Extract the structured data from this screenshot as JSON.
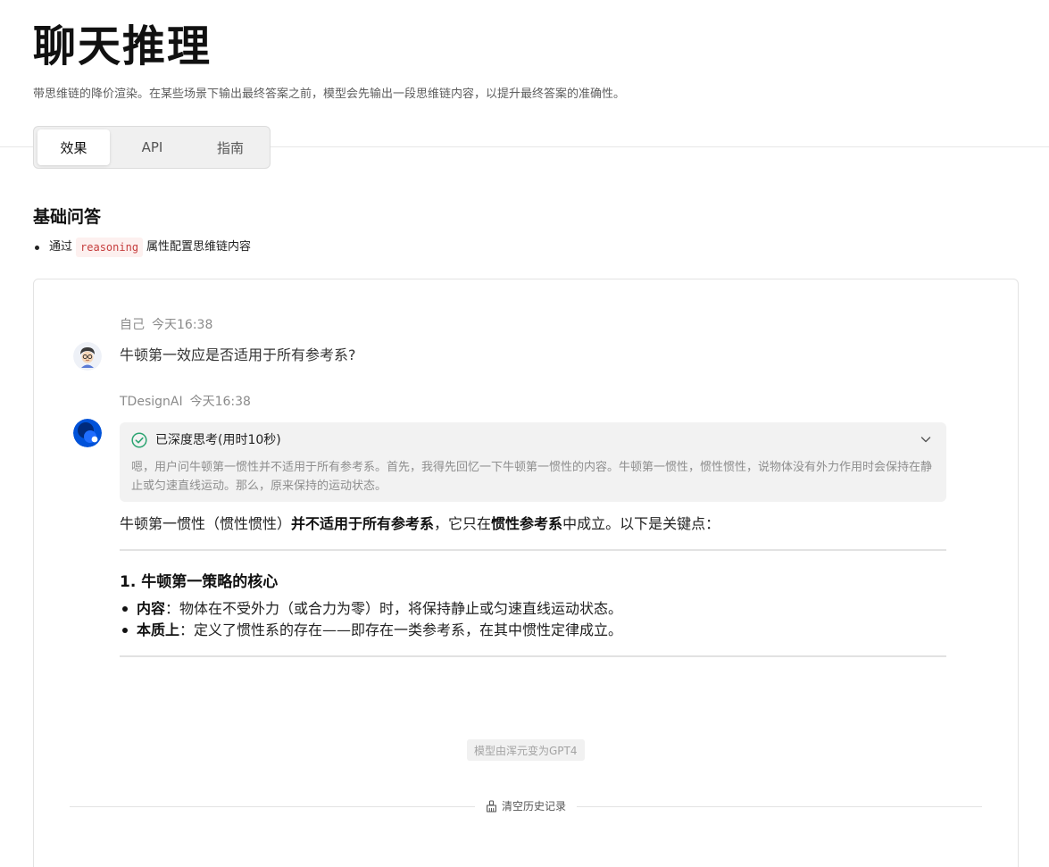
{
  "header": {
    "title": "聊天推理",
    "description": "带思维链的降价渲染。在某些场景下输出最终答案之前，模型会先输出一段思维链内容，以提升最终答案的准确性。"
  },
  "tabs": [
    {
      "label": "效果",
      "active": true
    },
    {
      "label": "API",
      "active": false
    },
    {
      "label": "指南",
      "active": false
    }
  ],
  "section": {
    "title": "基础问答",
    "bullet_prefix": "通过",
    "bullet_code": "reasoning",
    "bullet_suffix": "属性配置思维链内容"
  },
  "chat": {
    "user": {
      "name": "自己",
      "time": "今天16:38",
      "text": "牛顿第一效应是否适用于所有参考系?"
    },
    "assistant": {
      "name": "TDesignAI",
      "time": "今天16:38",
      "reasoning_status": "已深度思考(用时10秒)",
      "reasoning_text": "嗯，用户问牛顿第一惯性并不适用于所有参考系。首先，我得先回忆一下牛顿第一惯性的内容。牛顿第一惯性，惯性惯性，说物体没有外力作用时会保持在静止或匀速直线运动。那么，原来保持的运动状态。",
      "answer_lead_1": "牛顿第一惯性（惯性惯性）",
      "answer_lead_bold_1": "并不适用于所有参考系",
      "answer_lead_2": "，它只在",
      "answer_lead_bold_2": "惯性参考系",
      "answer_lead_3": "中成立。以下是关键点：",
      "heading": "1. 牛顿第一策略的核心",
      "points": [
        {
          "label": "内容",
          "text": "：物体在不受外力（或合力为零）时，将保持静止或匀速直线运动状态。"
        },
        {
          "label": "本质上",
          "text": "：定义了惯性系的存在——即存在一类参考系，在其中惯性定律成立。"
        }
      ]
    },
    "model_notice": "模型由浑元变为GPT4",
    "clear_label": "清空历史记录"
  },
  "colors": {
    "accent_blue": "#0052d9",
    "success_green": "#2ba471",
    "code_red": "#c53c3c"
  },
  "icons": [
    "check-circle-icon",
    "chevron-down-icon",
    "broom-icon"
  ]
}
